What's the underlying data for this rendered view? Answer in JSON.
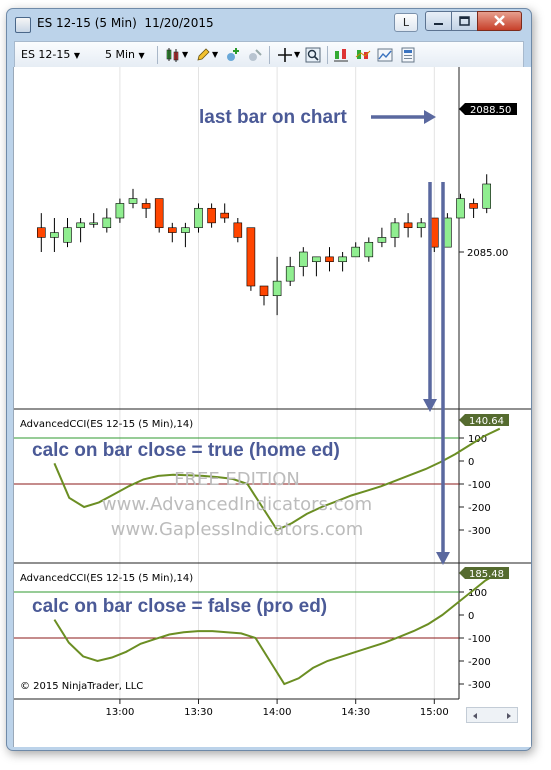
{
  "window": {
    "title": "ES 12-15 (5 Min)  11/20/2015",
    "layout_button": "L"
  },
  "toolbar": {
    "instrument": "ES 12-15",
    "interval": "5 Min"
  },
  "price_panel": {
    "last_price_label": "2088.50",
    "axis_labels": [
      "2085.00"
    ],
    "annotation": "last bar on chart",
    "candles": [
      {
        "o": 2086.25,
        "h": 2087.0,
        "l": 2085.0,
        "c": 2085.75
      },
      {
        "o": 2085.75,
        "h": 2086.75,
        "l": 2085.0,
        "c": 2086.0
      },
      {
        "o": 2085.5,
        "h": 2086.75,
        "l": 2085.25,
        "c": 2086.25
      },
      {
        "o": 2086.25,
        "h": 2086.75,
        "l": 2085.5,
        "c": 2086.5
      },
      {
        "o": 2086.5,
        "h": 2087.0,
        "l": 2086.25,
        "c": 2086.5
      },
      {
        "o": 2086.25,
        "h": 2087.25,
        "l": 2086.0,
        "c": 2086.75
      },
      {
        "o": 2086.75,
        "h": 2087.75,
        "l": 2086.5,
        "c": 2087.5
      },
      {
        "o": 2087.5,
        "h": 2088.25,
        "l": 2087.25,
        "c": 2087.75
      },
      {
        "o": 2087.5,
        "h": 2087.75,
        "l": 2086.75,
        "c": 2087.25
      },
      {
        "o": 2087.75,
        "h": 2087.75,
        "l": 2086.0,
        "c": 2086.25
      },
      {
        "o": 2086.25,
        "h": 2086.5,
        "l": 2085.5,
        "c": 2086.0
      },
      {
        "o": 2086.0,
        "h": 2086.5,
        "l": 2085.25,
        "c": 2086.25
      },
      {
        "o": 2086.25,
        "h": 2087.5,
        "l": 2086.0,
        "c": 2087.25
      },
      {
        "o": 2087.25,
        "h": 2087.5,
        "l": 2086.25,
        "c": 2086.5
      },
      {
        "o": 2087.0,
        "h": 2087.5,
        "l": 2086.5,
        "c": 2086.75
      },
      {
        "o": 2086.5,
        "h": 2086.75,
        "l": 2085.5,
        "c": 2085.75
      },
      {
        "o": 2086.25,
        "h": 2086.25,
        "l": 2083.0,
        "c": 2083.25
      },
      {
        "o": 2083.25,
        "h": 2083.25,
        "l": 2082.25,
        "c": 2082.75
      },
      {
        "o": 2082.75,
        "h": 2084.75,
        "l": 2081.75,
        "c": 2083.5
      },
      {
        "o": 2083.5,
        "h": 2084.75,
        "l": 2083.25,
        "c": 2084.25
      },
      {
        "o": 2084.25,
        "h": 2085.25,
        "l": 2083.75,
        "c": 2085.0
      },
      {
        "o": 2084.5,
        "h": 2084.75,
        "l": 2083.75,
        "c": 2084.75
      },
      {
        "o": 2084.75,
        "h": 2085.25,
        "l": 2084.0,
        "c": 2084.5
      },
      {
        "o": 2084.5,
        "h": 2085.0,
        "l": 2084.0,
        "c": 2084.75
      },
      {
        "o": 2084.75,
        "h": 2085.5,
        "l": 2084.75,
        "c": 2085.25
      },
      {
        "o": 2084.75,
        "h": 2085.75,
        "l": 2084.5,
        "c": 2085.5
      },
      {
        "o": 2085.5,
        "h": 2086.25,
        "l": 2085.25,
        "c": 2085.75
      },
      {
        "o": 2085.75,
        "h": 2086.75,
        "l": 2085.25,
        "c": 2086.5
      },
      {
        "o": 2086.5,
        "h": 2087.0,
        "l": 2085.75,
        "c": 2086.25
      },
      {
        "o": 2086.25,
        "h": 2086.75,
        "l": 2085.75,
        "c": 2086.5
      },
      {
        "o": 2086.75,
        "h": 2086.75,
        "l": 2085.0,
        "c": 2085.25
      },
      {
        "o": 2085.25,
        "h": 2087.0,
        "l": 2085.25,
        "c": 2086.75
      },
      {
        "o": 2086.75,
        "h": 2088.0,
        "l": 2086.75,
        "c": 2087.75
      },
      {
        "o": 2087.5,
        "h": 2087.75,
        "l": 2086.75,
        "c": 2087.25
      },
      {
        "o": 2087.25,
        "h": 2089.0,
        "l": 2087.0,
        "c": 2088.5
      }
    ]
  },
  "cci_panels": [
    {
      "title": "AdvancedCCI(ES 12-15 (5 Min),14)",
      "last_value": "140.64",
      "annotation": "calc on bar close = true (home ed)",
      "watermark": [
        "FREE EDITION",
        "www.AdvancedIndicators.com",
        "www.GaplessIndicators.com"
      ],
      "y_labels": [
        "100",
        "0",
        "-100",
        "-200",
        "-300"
      ],
      "values": [
        -10,
        -160,
        -200,
        -180,
        -145,
        -110,
        -80,
        -65,
        -60,
        -62,
        -65,
        -70,
        -78,
        -100,
        -200,
        -300,
        -270,
        -230,
        -200,
        -175,
        -150,
        -130,
        -110,
        -85,
        -60,
        -35,
        -5,
        30,
        70,
        110,
        140.64
      ]
    },
    {
      "title": "AdvancedCCI(ES 12-15 (5 Min),14)",
      "last_value": "185.48",
      "annotation": "calc on bar close = false (pro ed)",
      "copyright": "© 2015 NinjaTrader, LLC",
      "y_labels": [
        "100",
        "0",
        "-100",
        "-200",
        "-300"
      ],
      "values": [
        -20,
        -120,
        -180,
        -200,
        -185,
        -160,
        -125,
        -105,
        -85,
        -75,
        -70,
        -70,
        -75,
        -80,
        -100,
        -200,
        -300,
        -275,
        -230,
        -200,
        -180,
        -160,
        -140,
        -120,
        -95,
        -70,
        -40,
        0,
        50,
        100,
        150,
        185.48
      ]
    }
  ],
  "time_axis": {
    "labels": [
      "13:00",
      "13:30",
      "14:00",
      "14:30",
      "15:00"
    ]
  },
  "colors": {
    "up_candle": "#90ee90",
    "down_candle": "#ff4500",
    "cci_line": "#6b8e23",
    "annotation": "#4b5a97",
    "level_green": "#2f9a2f",
    "level_red": "#8b1a1a"
  }
}
